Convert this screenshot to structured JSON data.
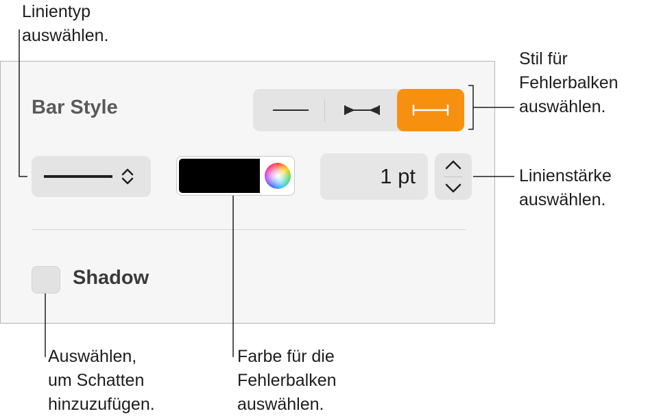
{
  "panel": {
    "bar_style_label": "Bar Style",
    "bar_style_options": [
      {
        "icon": "plain-line-icon",
        "selected": false
      },
      {
        "icon": "arrowhead-line-icon",
        "selected": false
      },
      {
        "icon": "end-cap-line-icon",
        "selected": true
      }
    ],
    "line_type_popup": {
      "icon": "solid-line-icon",
      "chevron": "up-down-chevron-icon"
    },
    "color_well": {
      "color": "#000000",
      "wheel_icon": "color-wheel-icon"
    },
    "line_width": {
      "value": "1 pt"
    },
    "shadow": {
      "label": "Shadow",
      "checked": false
    },
    "accent_color": "#f7900f"
  },
  "callouts": {
    "line_type": [
      "Linientyp",
      "auswählen."
    ],
    "bar_style": [
      "Stil für",
      "Fehlerbalken",
      "auswählen."
    ],
    "line_width": [
      "Linienstärke",
      "auswählen."
    ],
    "shadow": [
      "Auswählen,",
      "um Schatten",
      "hinzuzufügen."
    ],
    "color": [
      "Farbe für die",
      "Fehlerbalken",
      "auswählen."
    ]
  }
}
